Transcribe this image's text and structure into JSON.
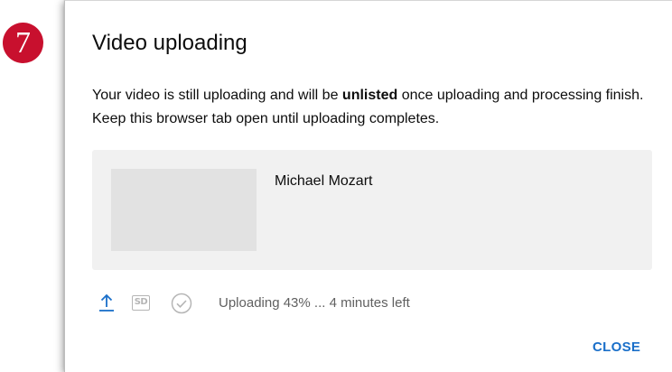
{
  "step_badge": {
    "label": "7",
    "color": "#c8102e"
  },
  "dialog": {
    "title": "Video uploading",
    "message": {
      "before": "Your video is still uploading and will be ",
      "emphasis": "unlisted",
      "after": " once uploading and processing finish. Keep this browser tab open until uploading completes."
    },
    "video": {
      "title": "Michael Mozart"
    },
    "status": {
      "icons": [
        "upload-icon",
        "sd-quality-icon",
        "check-circle-icon"
      ],
      "sd_label": "SD",
      "upload_progress_percent": 43,
      "text": "Uploading 43% ... 4 minutes left"
    },
    "close_label": "CLOSE"
  },
  "colors": {
    "accent": "#1a6fc9",
    "card_background": "#f1f1f1",
    "thumbnail_placeholder": "#e2e2e2",
    "status_text": "#606060"
  }
}
